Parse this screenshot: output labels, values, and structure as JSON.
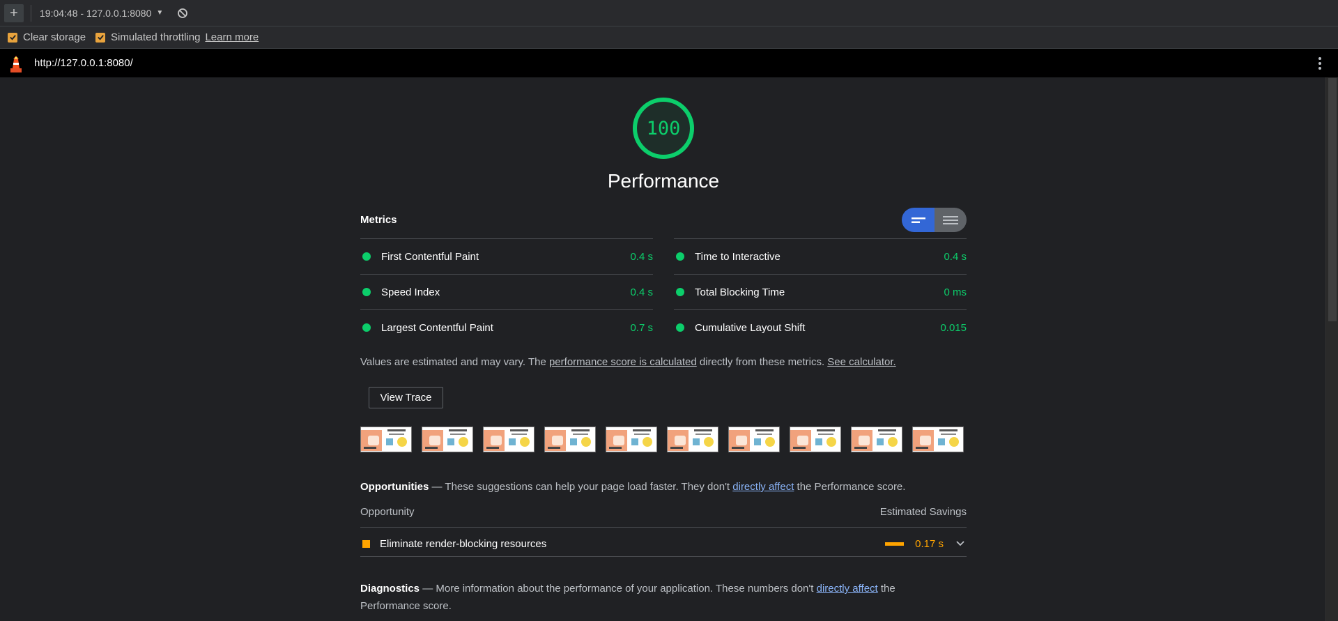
{
  "toolbar": {
    "new_report": "+",
    "report_selector": "19:04:48 - 127.0.0.1:8080",
    "caret": "▼",
    "clear_label": "clear-icon"
  },
  "options": {
    "clear_storage": "Clear storage",
    "simulated_throttling": "Simulated throttling",
    "learn_more": "Learn more"
  },
  "urlbar": {
    "url": "http://127.0.0.1:8080/"
  },
  "score": {
    "value": "100",
    "fraction": 1.0,
    "color": "#0cce6b",
    "title": "Performance"
  },
  "metrics": {
    "heading": "Metrics",
    "left": [
      {
        "label": "First Contentful Paint",
        "value": "0.4 s"
      },
      {
        "label": "Speed Index",
        "value": "0.4 s"
      },
      {
        "label": "Largest Contentful Paint",
        "value": "0.7 s"
      }
    ],
    "right": [
      {
        "label": "Time to Interactive",
        "value": "0.4 s"
      },
      {
        "label": "Total Blocking Time",
        "value": "0 ms"
      },
      {
        "label": "Cumulative Layout Shift",
        "value": "0.015"
      }
    ],
    "note_prefix": "Values are estimated and may vary. The ",
    "note_link": "performance score is calculated",
    "note_middle": " directly from these metrics. ",
    "note_calc": "See calculator."
  },
  "view_trace": "View Trace",
  "opportunities": {
    "heading": "Opportunities",
    "dash": " — ",
    "text_before": "These suggestions can help your page load faster. They don't ",
    "link": "directly affect",
    "text_after": " the Performance score.",
    "col_opportunity": "Opportunity",
    "col_savings": "Estimated Savings",
    "items": [
      {
        "label": "Eliminate render-blocking resources",
        "value": "0.17 s"
      }
    ]
  },
  "diagnostics": {
    "heading": "Diagnostics",
    "dash": " — ",
    "text_before": "More information about the performance of your application. These numbers don't ",
    "link": "directly affect",
    "text_after": " the Performance score."
  },
  "colors": {
    "pass": "#0cce6b",
    "average": "#ffa400",
    "accent": "#3367d6"
  }
}
